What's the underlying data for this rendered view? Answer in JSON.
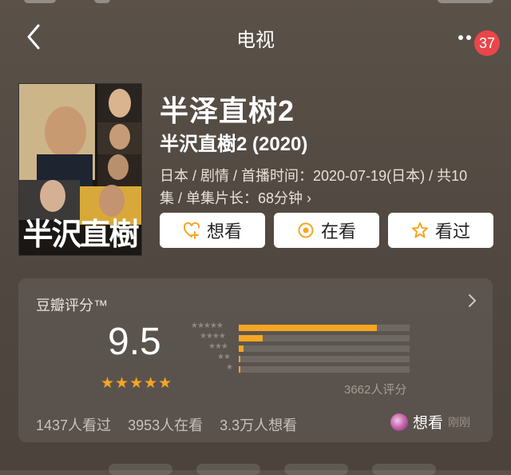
{
  "nav": {
    "title": "电视",
    "badge_count": "37"
  },
  "movie": {
    "title": "半泽直树2",
    "original_title": "半沢直樹2 (2020)",
    "meta_line1": "日本 / 剧情 / 首播时间：2020-07-19(日本) / 共10",
    "meta_line2": "集 / 单集片长：68分钟",
    "poster_text": "半沢直樹"
  },
  "actions": {
    "want": "想看",
    "watching": "在看",
    "watched": "看过"
  },
  "rating": {
    "label": "豆瓣评分™",
    "score": "9.5",
    "stars": "★★★★★",
    "distribution": [
      0.81,
      0.14,
      0.03,
      0.01,
      0.005
    ],
    "count_text": "3662人评分",
    "accent_color": "#f5a623"
  },
  "stats": {
    "watched": "1437人看过",
    "watching": "3953人在看",
    "want": "3.3万人想看"
  },
  "friend": {
    "action": "想看",
    "time": "刚刚"
  },
  "icons": {
    "back": "chevron-left-icon",
    "more": "more-dots-icon",
    "want": "heart-plus-icon",
    "watching": "target-circle-icon",
    "watched": "star-outline-icon",
    "card": "chevron-right-icon"
  }
}
